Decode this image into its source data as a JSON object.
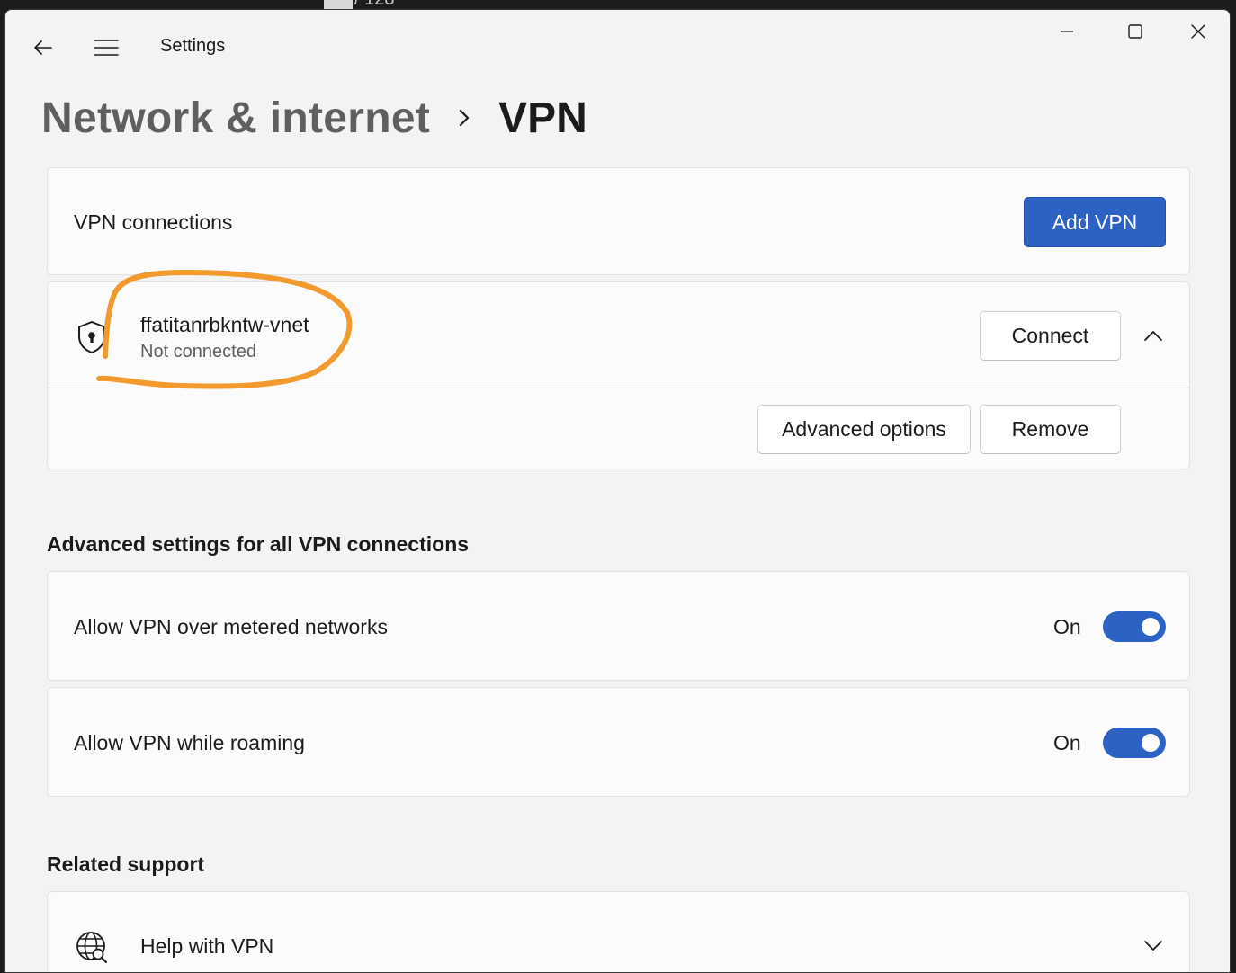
{
  "background_text": "/ 128",
  "titlebar": {
    "app_title": "Settings",
    "back_icon": "back-arrow-icon",
    "menu_icon": "hamburger-menu-icon"
  },
  "window_controls": {
    "minimize_icon": "minimize-icon",
    "maximize_icon": "maximize-icon",
    "close_icon": "close-icon"
  },
  "breadcrumb": {
    "parent": "Network & internet",
    "separator_icon": "chevron-right-icon",
    "current": "VPN"
  },
  "vpn_connections": {
    "label": "VPN connections",
    "add_button": "Add VPN"
  },
  "vpn_entry": {
    "icon": "shield-lock-icon",
    "name": "ffatitanrbkntw-vnet",
    "status": "Not connected",
    "connect_button": "Connect",
    "collapse_icon": "chevron-up-icon",
    "advanced_options_button": "Advanced options",
    "remove_button": "Remove"
  },
  "advanced_settings": {
    "title": "Advanced settings for all VPN connections",
    "items": [
      {
        "label": "Allow VPN over metered networks",
        "state": "On",
        "enabled": true
      },
      {
        "label": "Allow VPN while roaming",
        "state": "On",
        "enabled": true
      }
    ]
  },
  "related_support": {
    "title": "Related support",
    "items": [
      {
        "icon": "globe-search-icon",
        "label": "Help with VPN",
        "expand_icon": "chevron-down-icon"
      }
    ]
  },
  "colors": {
    "accent": "#2b62c4",
    "annotation": "#f29a2e",
    "window_bg": "#f3f3f3",
    "card_bg": "#fbfbfb"
  }
}
